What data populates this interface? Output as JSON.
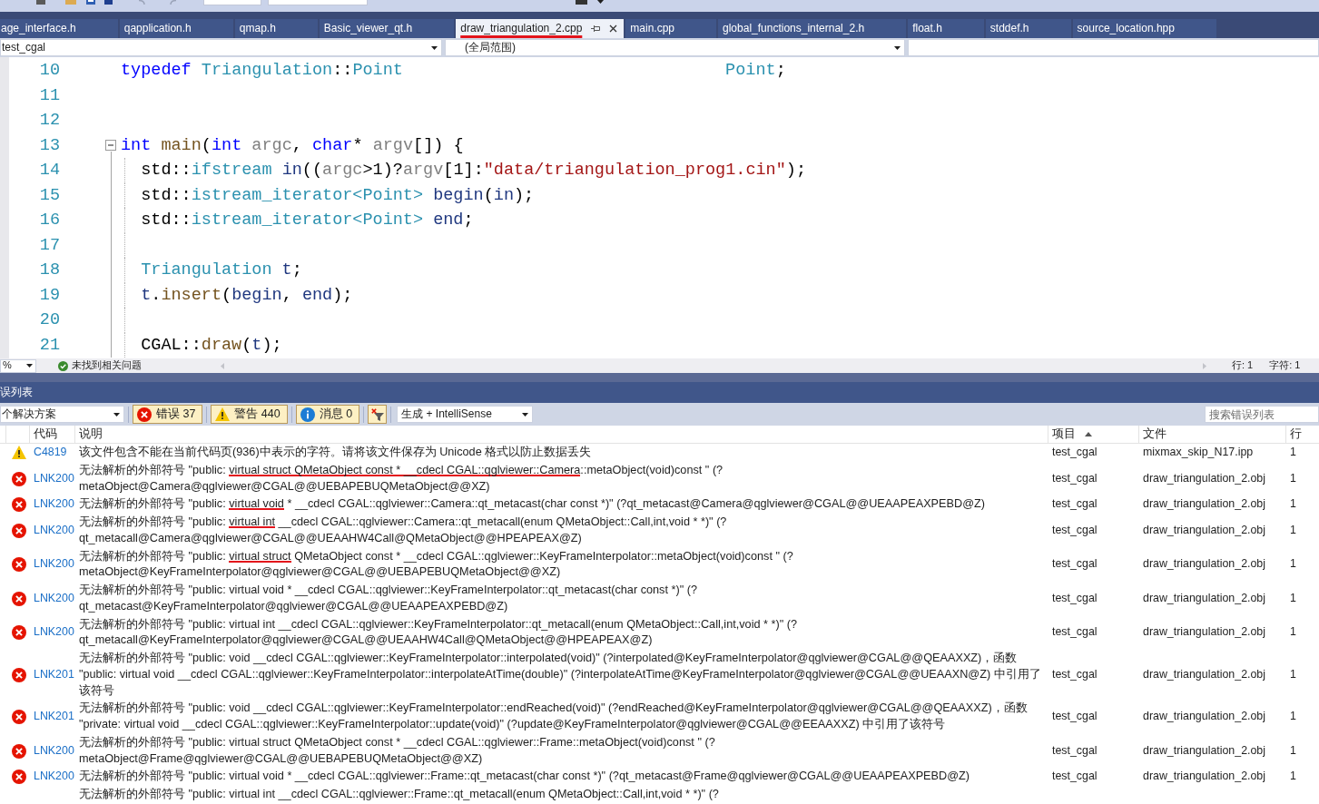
{
  "document_tabs": [
    {
      "label": "age_interface.h",
      "selected": false,
      "underlined": false
    },
    {
      "label": "qapplication.h",
      "selected": false,
      "underlined": false
    },
    {
      "label": "qmap.h",
      "selected": false,
      "underlined": false
    },
    {
      "label": "Basic_viewer_qt.h",
      "selected": false,
      "underlined": false
    },
    {
      "label": "draw_triangulation_2.cpp",
      "selected": true,
      "underlined": true
    },
    {
      "label": "main.cpp",
      "selected": false,
      "underlined": false
    },
    {
      "label": "global_functions_internal_2.h",
      "selected": false,
      "underlined": false
    },
    {
      "label": "float.h",
      "selected": false,
      "underlined": false
    },
    {
      "label": "stddef.h",
      "selected": false,
      "underlined": false
    },
    {
      "label": "source_location.hpp",
      "selected": false,
      "underlined": false
    }
  ],
  "navigation_bar": {
    "project": "test_cgal",
    "scope": "(全局范围)"
  },
  "editor": {
    "lines": [
      {
        "number": "10",
        "tokens": [
          {
            "text": "typedef",
            "kind": "keyword"
          },
          {
            "text": " Triangulation",
            "kind": "type"
          },
          {
            "text": "::",
            "kind": "plain"
          },
          {
            "text": "Point",
            "kind": "type"
          },
          {
            "text": "\t\t\t\t\t\t\t\tPoint",
            "kind": "type"
          },
          {
            "text": ";",
            "kind": "plain"
          }
        ]
      },
      {
        "number": "11"
      },
      {
        "number": "12"
      },
      {
        "number": "13",
        "expanded": true,
        "tokens": [
          {
            "text": "int",
            "kind": "keyword"
          },
          {
            "text": " main",
            "kind": "function"
          },
          {
            "text": "(",
            "kind": "plain"
          },
          {
            "text": "int",
            "kind": "keyword"
          },
          {
            "text": " argc",
            "kind": "param"
          },
          {
            "text": ", ",
            "kind": "plain"
          },
          {
            "text": "char",
            "kind": "keyword"
          },
          {
            "text": "* ",
            "kind": "plain"
          },
          {
            "text": "argv",
            "kind": "param"
          },
          {
            "text": "[]) {",
            "kind": "plain"
          }
        ],
        "children": [
          {
            "number": "14",
            "tokens": [
              {
                "text": "std::",
                "kind": "plain"
              },
              {
                "text": "ifstream",
                "kind": "type"
              },
              {
                "text": " in",
                "kind": "local"
              },
              {
                "text": "((",
                "kind": "plain"
              },
              {
                "text": "argc",
                "kind": "param"
              },
              {
                "text": ">1)?",
                "kind": "plain"
              },
              {
                "text": "argv",
                "kind": "param"
              },
              {
                "text": "[1]:",
                "kind": "plain"
              },
              {
                "text": "\"data/triangulation_prog1.cin\"",
                "kind": "string"
              },
              {
                "text": ");",
                "kind": "plain"
              }
            ]
          },
          {
            "number": "15",
            "tokens": [
              {
                "text": "std::",
                "kind": "plain"
              },
              {
                "text": "istream_iterator<Point>",
                "kind": "type"
              },
              {
                "text": " begin",
                "kind": "local"
              },
              {
                "text": "(",
                "kind": "plain"
              },
              {
                "text": "in",
                "kind": "local"
              },
              {
                "text": ");",
                "kind": "plain"
              }
            ]
          },
          {
            "number": "16",
            "tokens": [
              {
                "text": "std::",
                "kind": "plain"
              },
              {
                "text": "istream_iterator<Point>",
                "kind": "type"
              },
              {
                "text": " end",
                "kind": "local"
              },
              {
                "text": ";",
                "kind": "plain"
              }
            ]
          },
          {
            "number": "17"
          },
          {
            "number": "18",
            "tokens": [
              {
                "text": "Triangulation",
                "kind": "type"
              },
              {
                "text": " t",
                "kind": "local"
              },
              {
                "text": ";",
                "kind": "plain"
              }
            ]
          },
          {
            "number": "19",
            "tokens": [
              {
                "text": "t",
                "kind": "local"
              },
              {
                "text": ".",
                "kind": "plain"
              },
              {
                "text": "insert",
                "kind": "function"
              },
              {
                "text": "(",
                "kind": "plain"
              },
              {
                "text": "begin",
                "kind": "local"
              },
              {
                "text": ", ",
                "kind": "plain"
              },
              {
                "text": "end",
                "kind": "local"
              },
              {
                "text": ");",
                "kind": "plain"
              }
            ]
          },
          {
            "number": "20"
          },
          {
            "number": "21",
            "tokens": [
              {
                "text": "CGAL::",
                "kind": "plain"
              },
              {
                "text": "draw",
                "kind": "function"
              },
              {
                "text": "(",
                "kind": "plain"
              },
              {
                "text": "t",
                "kind": "local"
              },
              {
                "text": ");",
                "kind": "plain"
              }
            ]
          }
        ]
      }
    ]
  },
  "editor_status": {
    "zoom": "%",
    "issues": "未找到相关问题",
    "line": "行: 1",
    "column": "字符: 1"
  },
  "error_list": {
    "title": "误列表",
    "scope": "个解决方案",
    "filters": [
      {
        "kind": "error",
        "label": "错误 37",
        "on": true
      },
      {
        "kind": "warning",
        "label": "警告 440",
        "on": true
      },
      {
        "kind": "message",
        "label": "消息 0",
        "on": true
      }
    ],
    "filter_toggle": {
      "on": true
    },
    "source": "生成 + IntelliSense",
    "search": {
      "placeholder": "搜索错误列表"
    },
    "columns": [
      {
        "label": "代码",
        "sorted": false
      },
      {
        "label": "说明",
        "sorted": false
      },
      {
        "label": "项目",
        "sorted": true
      },
      {
        "label": "文件",
        "sorted": false
      },
      {
        "label": "行",
        "sorted": false
      }
    ],
    "rows": [
      {
        "kind": "warning",
        "code": "C4819",
        "description": [
          {
            "text": "该文件包含不能在当前代码页(936)中表示的字符。请将该文件保存为 Unicode 格式以防止数据丢失",
            "underlined": false
          }
        ],
        "project": "test_cgal",
        "file": "mixmax_skip_N17.ipp",
        "line": "1"
      },
      {
        "kind": "error",
        "code": "LNK200",
        "description": [
          {
            "text": "无法解析的外部符号 \"public: ",
            "underlined": false
          },
          {
            "text": "virtual struct QMetaObject const * __cdecl CGAL::qglviewer::Camera",
            "underlined": true
          },
          {
            "text": "::metaObject(void)const \" (?metaObject@Camera@qglviewer@CGAL@@UEBAPEBUQMetaObject@@XZ)",
            "underlined": false
          }
        ],
        "project": "test_cgal",
        "file": "draw_triangulation_2.obj",
        "line": "1"
      },
      {
        "kind": "error",
        "code": "LNK200",
        "description": [
          {
            "text": "无法解析的外部符号 \"public: ",
            "underlined": false
          },
          {
            "text": "virtual void",
            "underlined": true
          },
          {
            "text": " * __cdecl CGAL::qglviewer::Camera::qt_metacast(char const *)\" (?qt_metacast@Camera@qglviewer@CGAL@@UEAAPEAXPEBD@Z)",
            "underlined": false
          }
        ],
        "project": "test_cgal",
        "file": "draw_triangulation_2.obj",
        "line": "1"
      },
      {
        "kind": "error",
        "code": "LNK200",
        "description": [
          {
            "text": "无法解析的外部符号 \"public: ",
            "underlined": false
          },
          {
            "text": "virtual int",
            "underlined": true
          },
          {
            "text": " __cdecl CGAL::qglviewer::Camera::qt_metacall(enum QMetaObject::Call,int,void * *)\" (?qt_metacall@Camera@qglviewer@CGAL@@UEAAHW4Call@QMetaObject@@HPEAPEAX@Z)",
            "underlined": false
          }
        ],
        "project": "test_cgal",
        "file": "draw_triangulation_2.obj",
        "line": "1"
      },
      {
        "kind": "error",
        "code": "LNK200",
        "description": [
          {
            "text": "无法解析的外部符号 \"public: ",
            "underlined": false
          },
          {
            "text": "virtual struct",
            "underlined": true
          },
          {
            "text": " QMetaObject const * __cdecl CGAL::qglviewer::KeyFrameInterpolator::metaObject(void)const \" (?metaObject@KeyFrameInterpolator@qglviewer@CGAL@@UEBAPEBUQMetaObject@@XZ)",
            "underlined": false
          }
        ],
        "project": "test_cgal",
        "file": "draw_triangulation_2.obj",
        "line": "1"
      },
      {
        "kind": "error",
        "code": "LNK200",
        "description": [
          {
            "text": "无法解析的外部符号 \"public: virtual void * __cdecl CGAL::qglviewer::KeyFrameInterpolator::qt_metacast(char const *)\" (?qt_metacast@KeyFrameInterpolator@qglviewer@CGAL@@UEAAPEAXPEBD@Z)",
            "underlined": false
          }
        ],
        "project": "test_cgal",
        "file": "draw_triangulation_2.obj",
        "line": "1"
      },
      {
        "kind": "error",
        "code": "LNK200",
        "description": [
          {
            "text": "无法解析的外部符号 \"public: virtual int __cdecl CGAL::qglviewer::KeyFrameInterpolator::qt_metacall(enum QMetaObject::Call,int,void * *)\" (?qt_metacall@KeyFrameInterpolator@qglviewer@CGAL@@UEAAHW4Call@QMetaObject@@HPEAPEAX@Z)",
            "underlined": false
          }
        ],
        "project": "test_cgal",
        "file": "draw_triangulation_2.obj",
        "line": "1"
      },
      {
        "kind": "error",
        "code": "LNK201",
        "description": [
          {
            "text": "无法解析的外部符号 \"public: void __cdecl CGAL::qglviewer::KeyFrameInterpolator::interpolated(void)\" (?interpolated@KeyFrameInterpolator@qglviewer@CGAL@@QEAAXXZ)，函数 \"public: virtual void __cdecl CGAL::qglviewer::KeyFrameInterpolator::interpolateAtTime(double)\" (?interpolateAtTime@KeyFrameInterpolator@qglviewer@CGAL@@UEAAXN@Z) 中引用了该符号",
            "underlined": false
          }
        ],
        "project": "test_cgal",
        "file": "draw_triangulation_2.obj",
        "line": "1"
      },
      {
        "kind": "error",
        "code": "LNK201",
        "description": [
          {
            "text": "无法解析的外部符号 \"public: void __cdecl CGAL::qglviewer::KeyFrameInterpolator::endReached(void)\" (?endReached@KeyFrameInterpolator@qglviewer@CGAL@@QEAAXXZ)，函数 \"private: virtual void __cdecl CGAL::qglviewer::KeyFrameInterpolator::update(void)\" (?update@KeyFrameInterpolator@qglviewer@CGAL@@EEAAXXZ) 中引用了该符号",
            "underlined": false
          }
        ],
        "project": "test_cgal",
        "file": "draw_triangulation_2.obj",
        "line": "1"
      },
      {
        "kind": "error",
        "code": "LNK200",
        "description": [
          {
            "text": "无法解析的外部符号 \"public: virtual struct QMetaObject const * __cdecl CGAL::qglviewer::Frame::metaObject(void)const \" (?metaObject@Frame@qglviewer@CGAL@@UEBAPEBUQMetaObject@@XZ)",
            "underlined": false
          }
        ],
        "project": "test_cgal",
        "file": "draw_triangulation_2.obj",
        "line": "1"
      },
      {
        "kind": "error",
        "code": "LNK200",
        "description": [
          {
            "text": "无法解析的外部符号 \"public: virtual void * __cdecl CGAL::qglviewer::Frame::qt_metacast(char const *)\" (?qt_metacast@Frame@qglviewer@CGAL@@UEAAPEAXPEBD@Z)",
            "underlined": false
          }
        ],
        "project": "test_cgal",
        "file": "draw_triangulation_2.obj",
        "line": "1"
      },
      {
        "description": [
          {
            "text": "无法解析的外部符号 \"public: virtual int __cdecl CGAL::qglviewer::Frame::qt_metacall(enum QMetaObject::Call,int,void * *)\" (?",
            "underlined": false
          }
        ]
      }
    ]
  }
}
